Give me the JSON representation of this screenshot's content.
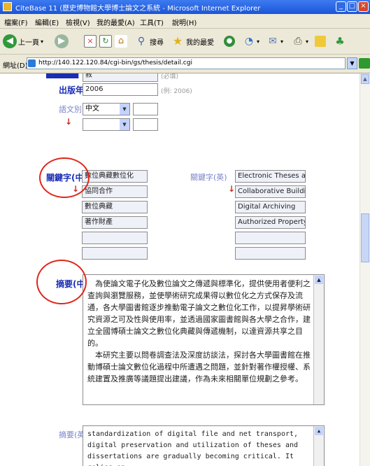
{
  "window": {
    "title": "CiteBase 11 (歷史博物館大學博士論文之系統 - Microsoft Internet Explorer",
    "controls": [
      "_",
      "□",
      "×"
    ]
  },
  "menu": [
    "檔案(F)",
    "編輯(E)",
    "檢視(V)",
    "我的最愛(A)",
    "工具(T)",
    "說明(H)"
  ],
  "toolbar": {
    "back": "上一頁",
    "search": "搜尋",
    "favorites": "我的最愛"
  },
  "address": {
    "label": "網址(D)",
    "url": "http://140.122.120.84/cgi-bin/gs/thesis/detail.cgi"
  },
  "form": {
    "top_value": "教",
    "top_hint": "(必填)",
    "year_label": "出版年",
    "year_value": "2006",
    "year_hint": "(例: 2006)",
    "language_label": "語文別",
    "language_value": "中文",
    "keywords_zh_label": "關鍵字(中)",
    "keywords_zh": [
      "數位典藏數位化",
      "協同合作",
      "數位典藏",
      "著作財產",
      "",
      ""
    ],
    "keywords_en_label": "關鍵字(英)",
    "keywords_en": [
      "Electronic Theses and Dissertations",
      "Collaborative Building and",
      "Digital Archiving",
      "Authorized Property",
      "",
      ""
    ],
    "abstract_zh_label": "摘要(中)",
    "abstract_zh_p1": "　為使論文電子化及數位論文之傳遞與標準化，提供使用者便利之查詢與瀏覽服務，並使學術研究成果得以數位化之方式保存及流通，各大學圖書館逐步推動電子論文之數位化工作，以提昇學術研究資源之可及性與使用率，並透過國家圖書館與各大學之合作，建立全國博碩士論文之數位化典藏與傳遞機制，以達資源共享之目的。",
    "abstract_zh_p2": "　本研究主要以問卷調查法及深度訪談法，探討各大學圖書館在推動博碩士論文數位化過程中所遭遇之問題，並針對著作權授權、系統建置及推廣等議題提出建議，作為未來相關單位規劃之參考。",
    "abstract_en_label": "摘要(英)",
    "abstract_en": "standardization of digital file and net transport, digital preservation and utilization of theses and dissertations are gradually becoming critical.  It relies on"
  }
}
